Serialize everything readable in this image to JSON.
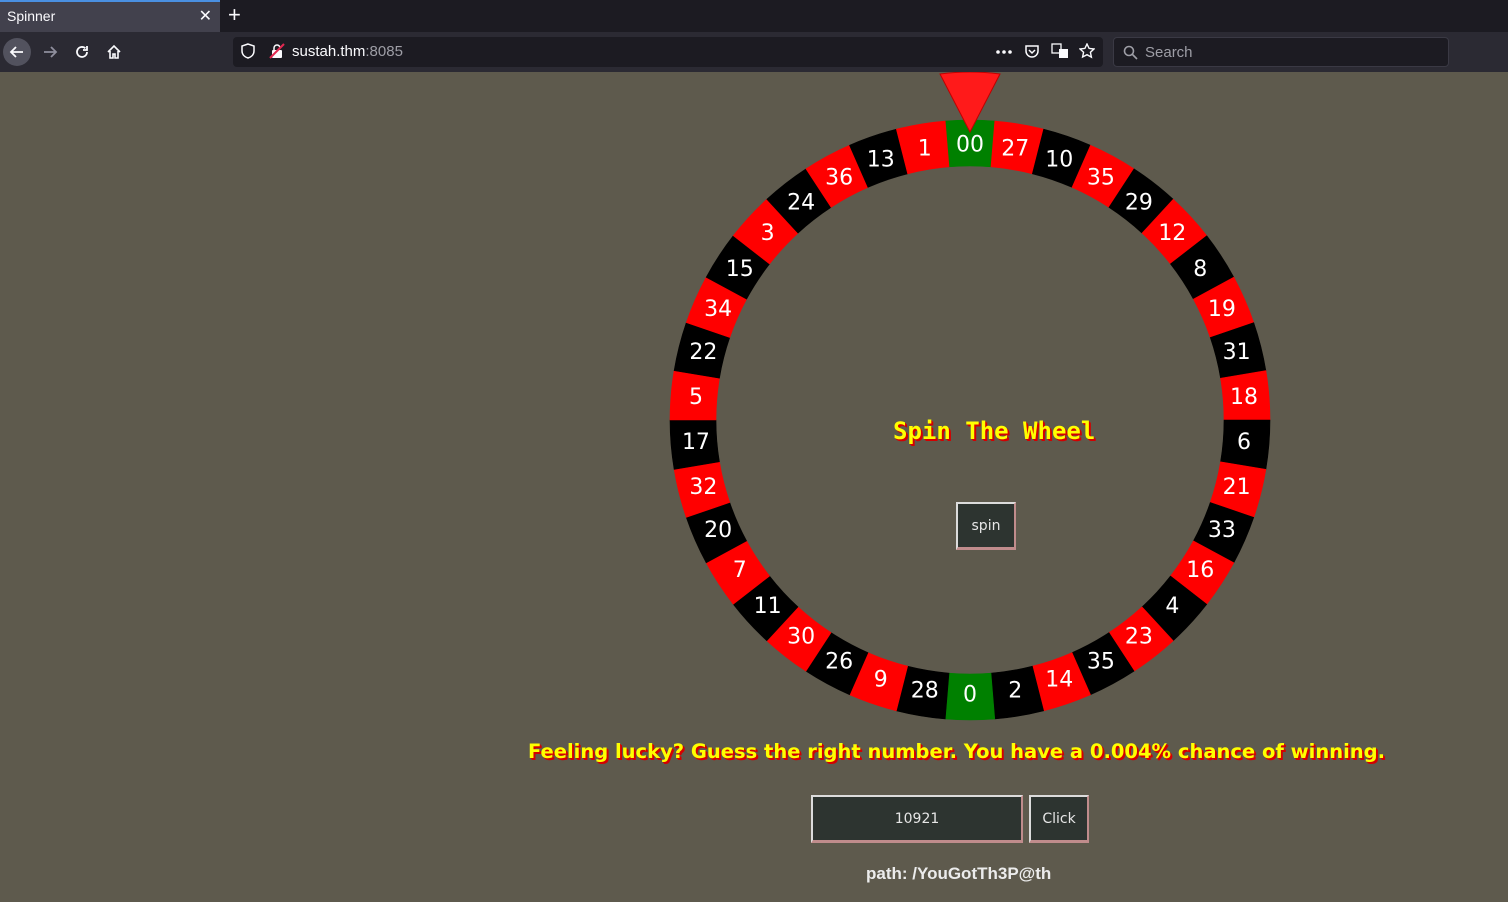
{
  "browser": {
    "tab_title": "Spinner",
    "tab_close": "✕",
    "new_tab": "+",
    "url_host": "sustah.thm",
    "url_port": ":8085",
    "search_placeholder": "Search"
  },
  "page": {
    "wheel_title": "Spin The Wheel",
    "spin_label": "spin",
    "wheel_numbers": [
      "00",
      "27",
      "10",
      "35",
      "29",
      "12",
      "8",
      "19",
      "31",
      "18",
      "6",
      "21",
      "33",
      "16",
      "4",
      "23",
      "35",
      "14",
      "2",
      "0",
      "28",
      "9",
      "26",
      "30",
      "11",
      "7",
      "20",
      "32",
      "17",
      "5",
      "22",
      "34",
      "15",
      "3",
      "24",
      "36",
      "13",
      "1"
    ],
    "wheel_colors": [
      "green",
      "red",
      "black",
      "red",
      "black",
      "red",
      "black",
      "red",
      "black",
      "red",
      "black",
      "red",
      "black",
      "red",
      "black",
      "red",
      "black",
      "red",
      "black",
      "green",
      "black",
      "red",
      "black",
      "red",
      "black",
      "red",
      "black",
      "red",
      "black",
      "red",
      "black",
      "red",
      "black",
      "red",
      "black",
      "red",
      "black",
      "red"
    ],
    "palette": {
      "red": "#ff0000",
      "black": "#000000",
      "green": "#008000",
      "pointer": "#ff1a1a",
      "background": "#5e5a4d",
      "title_text": "#ffff00"
    },
    "lucky_text": "Feeling lucky? Guess the right number. You have a 0.004% chance of winning.",
    "guess_value": "10921",
    "click_label": "Click",
    "path_text": "path: /YouGotTh3P@th"
  }
}
